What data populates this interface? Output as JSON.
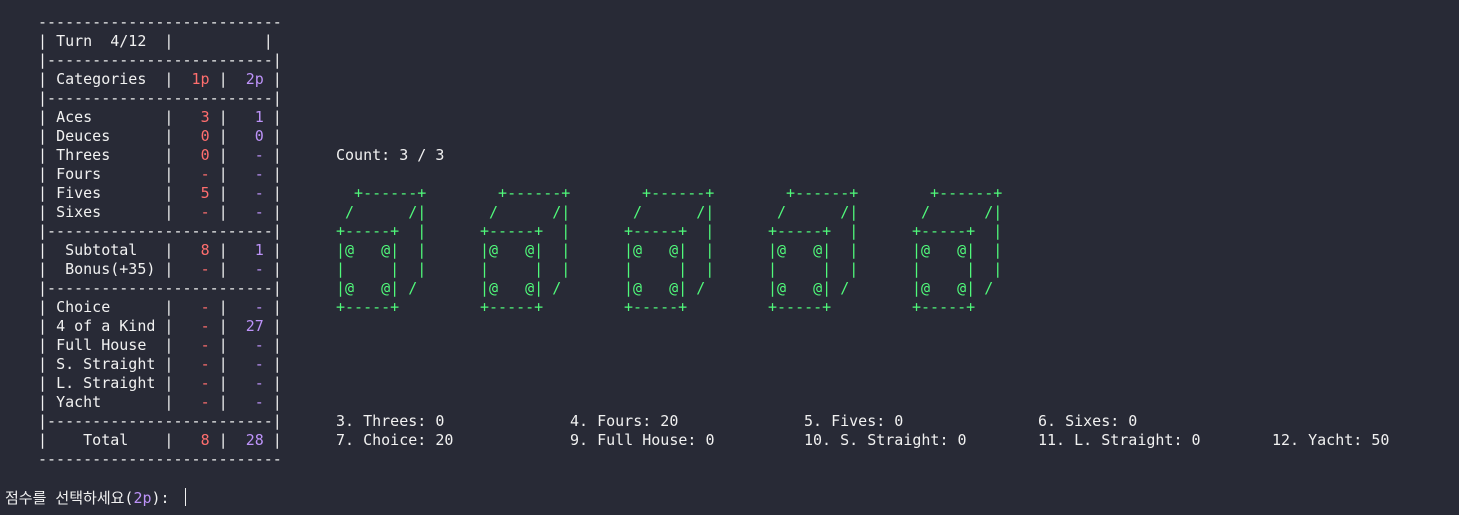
{
  "scoreboard": {
    "border": "---------------------------",
    "turn_label": "Turn",
    "turn_value": "4/12",
    "categories_header": "Categories",
    "p1_header": "1p",
    "p2_header": "2p",
    "upper": [
      {
        "name": "Aces",
        "p1": "3",
        "p2": "1"
      },
      {
        "name": "Deuces",
        "p1": "0",
        "p2": "0"
      },
      {
        "name": "Threes",
        "p1": "0",
        "p2": "-"
      },
      {
        "name": "Fours",
        "p1": "-",
        "p2": "-"
      },
      {
        "name": "Fives",
        "p1": "5",
        "p2": "-"
      },
      {
        "name": "Sixes",
        "p1": "-",
        "p2": "-"
      }
    ],
    "subtotal": {
      "name": "Subtotal",
      "p1": "8",
      "p2": "1"
    },
    "bonus": {
      "name": "Bonus(+35)",
      "p1": "-",
      "p2": "-"
    },
    "lower": [
      {
        "name": "Choice",
        "p1": "-",
        "p2": "-"
      },
      {
        "name": "4 of a Kind",
        "p1": "-",
        "p2": "27"
      },
      {
        "name": "Full House",
        "p1": "-",
        "p2": "-"
      },
      {
        "name": "S. Straight",
        "p1": "-",
        "p2": "-"
      },
      {
        "name": "L. Straight",
        "p1": "-",
        "p2": "-"
      },
      {
        "name": "Yacht",
        "p1": "-",
        "p2": "-"
      }
    ],
    "total": {
      "name": "Total",
      "p1": "8",
      "p2": "28"
    }
  },
  "count_label": "Count: 3 / 3",
  "dice": [
    {
      "value": 4
    },
    {
      "value": 4
    },
    {
      "value": 4
    },
    {
      "value": 4
    },
    {
      "value": 4
    }
  ],
  "options": [
    "3. Threes: 0",
    "4. Fours: 20",
    "5. Fives: 0",
    "6. Sixes: 0",
    "7. Choice: 20",
    "9. Full House: 0",
    "10. S. Straight: 0",
    "11. L. Straight: 0",
    "12. Yacht: 50"
  ],
  "prompt": {
    "text": "점수를 선택하세요(",
    "player": "2p",
    "suffix": "): "
  },
  "colors": {
    "background": "#282a36",
    "text": "#f1f1f1",
    "player1": "#ff6e6e",
    "player2": "#bd93f9",
    "dice": "#50fa7b"
  }
}
